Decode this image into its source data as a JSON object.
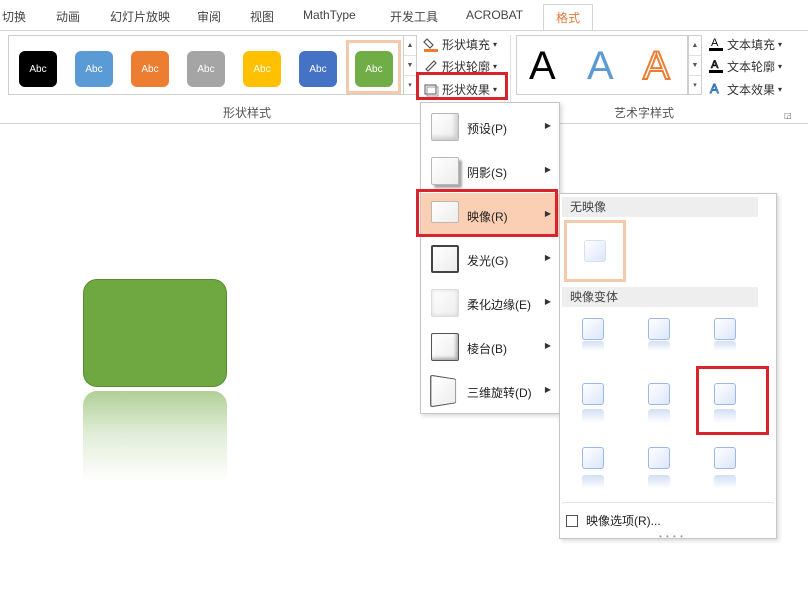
{
  "tabs": [
    {
      "label": "切换"
    },
    {
      "label": "动画"
    },
    {
      "label": "幻灯片放映"
    },
    {
      "label": "审阅"
    },
    {
      "label": "视图"
    },
    {
      "label": "MathType"
    },
    {
      "label": "开发工具"
    },
    {
      "label": "ACROBAT"
    },
    {
      "label": "格式",
      "active": true
    }
  ],
  "shape_styles": {
    "swatch_text": "Abc",
    "colors": [
      "#000000",
      "#5b9bd5",
      "#ed7d31",
      "#a5a5a5",
      "#ffc000",
      "#4472c4",
      "#70ad47"
    ],
    "selected_index": 6,
    "group_label": "形状样式"
  },
  "commands": {
    "fill": "形状填充",
    "outline": "形状轮廓",
    "effects": "形状效果"
  },
  "wordart": {
    "letter": "A",
    "group_label": "艺术字样式",
    "text_fill": "文本填充",
    "text_outline": "文本轮廓",
    "text_effects": "文本效果"
  },
  "effects_menu": {
    "items": [
      {
        "label": "预设(P)",
        "icon": "preset-icon"
      },
      {
        "label": "阴影(S)",
        "icon": "shadow-icon"
      },
      {
        "label": "映像(R)",
        "icon": "reflection-icon",
        "highlighted": true
      },
      {
        "label": "发光(G)",
        "icon": "glow-icon"
      },
      {
        "label": "柔化边缘(E)",
        "icon": "soft-edges-icon"
      },
      {
        "label": "棱台(B)",
        "icon": "bevel-icon"
      },
      {
        "label": "三维旋转(D)",
        "icon": "3d-rotation-icon"
      }
    ]
  },
  "reflection_submenu": {
    "no_reflection_header": "无映像",
    "variations_header": "映像变体",
    "selected_variation": "row 2, column 3",
    "options_label": "映像选项(R)..."
  },
  "colors": {
    "accent_orange": "#e07b3c",
    "highlight_red": "#d8242c",
    "menu_highlight": "#fbcfb4",
    "shape_green": "#6fa840"
  }
}
